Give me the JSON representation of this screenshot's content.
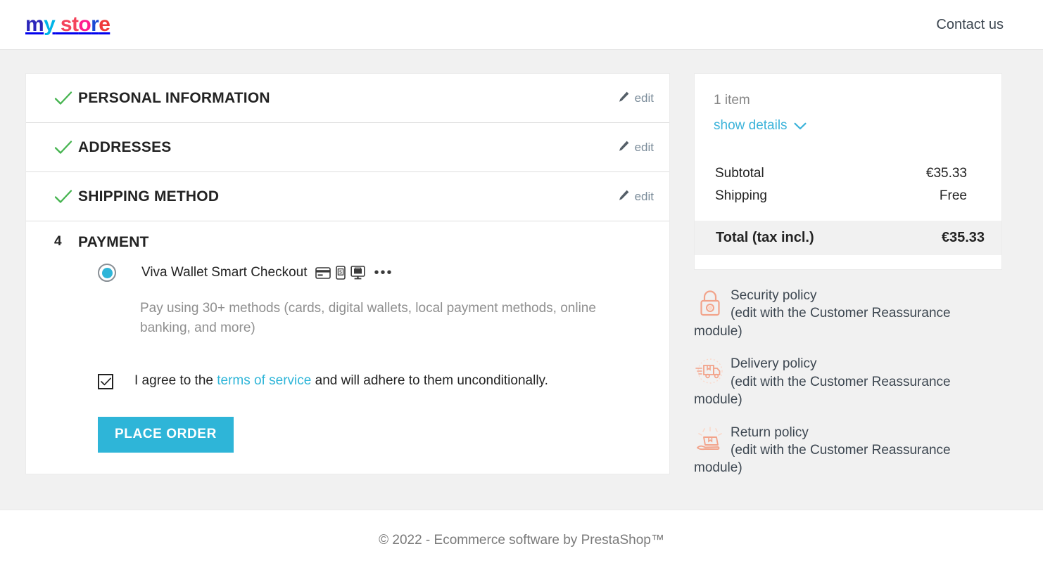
{
  "header": {
    "logo_parts": [
      {
        "text": "m",
        "color": "#2b25ba"
      },
      {
        "text": "y",
        "color": "#00b4e8"
      },
      {
        "text": " st",
        "color": "#f4445c"
      },
      {
        "text": "o",
        "color": "#ff1d8e"
      },
      {
        "text": "r",
        "color": "#1b49d4"
      },
      {
        "text": "e",
        "color": "#ef3b3b"
      }
    ],
    "logo_text": "my store",
    "contact_label": "Contact us"
  },
  "checkout": {
    "steps": [
      {
        "title": "Personal Information",
        "state": "complete",
        "edit_label": "edit"
      },
      {
        "title": "Addresses",
        "state": "complete",
        "edit_label": "edit"
      },
      {
        "title": "Shipping Method",
        "state": "complete",
        "edit_label": "edit"
      }
    ],
    "payment_step": {
      "number": "4",
      "title": "Payment",
      "option": {
        "label": "Viva Wallet Smart Checkout",
        "selected": true,
        "icons": [
          "credit-card-icon",
          "mobile-payment-icon",
          "online-payment-icon",
          "more-methods-icon"
        ],
        "more_glyph": "•••",
        "description": "Pay using 30+ methods (cards, digital wallets, local payment methods, online banking, and more)"
      },
      "terms": {
        "checked": true,
        "prefix": "I agree to the ",
        "link_label": "terms of service",
        "suffix": " and will adhere to them unconditionally."
      },
      "place_order_label": "Place order"
    }
  },
  "summary": {
    "item_count_label": "1 item",
    "show_details_label": "show details",
    "rows": [
      {
        "label": "Subtotal",
        "value": "€35.33"
      },
      {
        "label": "Shipping",
        "value": "Free"
      }
    ],
    "total_label": "Total (tax incl.)",
    "total_value": "€35.33"
  },
  "policies": [
    {
      "icon": "lock-icon",
      "title": "Security policy",
      "subtitle": "(edit with the Customer Reassurance module)"
    },
    {
      "icon": "delivery-truck-icon",
      "title": "Delivery policy",
      "subtitle": "(edit with the Customer Reassurance module)"
    },
    {
      "icon": "return-box-icon",
      "title": "Return policy",
      "subtitle": "(edit with the Customer Reassurance module)"
    }
  ],
  "footer": {
    "copyright": "© 2022 - Ecommerce software by PrestaShop™"
  },
  "colors": {
    "accent": "#2eb5d8",
    "link": "#3cb3da",
    "check_green": "#46b450",
    "policy_icon": "#f2a38a",
    "page_bg": "#f1f1f1"
  }
}
